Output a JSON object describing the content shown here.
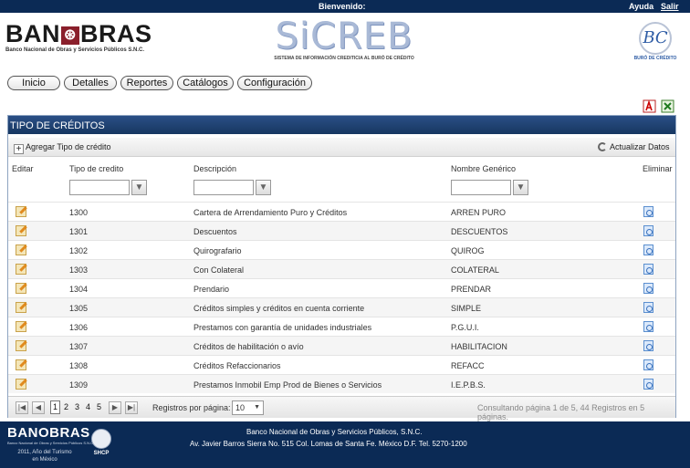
{
  "topbar": {
    "welcome": "Bienvenido:",
    "help": "Ayuda",
    "logout": "Salir"
  },
  "header": {
    "brand_word_left": "BAN",
    "brand_word_right": "BRAS",
    "brand_subtitle": "Banco Nacional de Obras y Servicios Públicos S.N.C.",
    "system_name": "SiCREB",
    "system_subtitle": "SISTEMA DE INFORMACIÓN CREDITICIA AL BURÓ DE CRÉDITO",
    "bc_logo_text": "BC",
    "bc_caption": "BURÓ DE CRÉDITO"
  },
  "nav": [
    "Inicio",
    "Detalles",
    "Reportes",
    "Catálogos",
    "Configuración"
  ],
  "toolbar": {
    "pdf_icon": "pdf-export-icon",
    "excel_icon": "excel-export-icon"
  },
  "grid": {
    "title": "TIPO DE CRÉDITOS",
    "add_label": "Agregar Tipo de crédito",
    "refresh_label": "Actualizar Datos",
    "columns": {
      "edit": "Editar",
      "type": "Tipo de credito",
      "description": "Descripción",
      "generic": "Nombre Genérico",
      "delete": "Eliminar"
    },
    "filters": {
      "type": "",
      "description": "",
      "generic": ""
    },
    "rows": [
      {
        "type": "1300",
        "description": "Cartera de Arrendamiento Puro y Créditos",
        "generic": "ARREN PURO"
      },
      {
        "type": "1301",
        "description": "Descuentos",
        "generic": "DESCUENTOS"
      },
      {
        "type": "1302",
        "description": "Quirografario",
        "generic": "QUIROG"
      },
      {
        "type": "1303",
        "description": "Con Colateral",
        "generic": "COLATERAL"
      },
      {
        "type": "1304",
        "description": "Prendario",
        "generic": "PRENDAR"
      },
      {
        "type": "1305",
        "description": "Créditos simples y créditos en cuenta corriente",
        "generic": "SIMPLE"
      },
      {
        "type": "1306",
        "description": "Prestamos con garantía de unidades industriales",
        "generic": "P.G.U.I."
      },
      {
        "type": "1307",
        "description": "Créditos de habilitación o avío",
        "generic": "HABILITACION"
      },
      {
        "type": "1308",
        "description": "Créditos Refaccionarios",
        "generic": "REFACC"
      },
      {
        "type": "1309",
        "description": "Prestamos Inmobil Emp Prod de Bienes o Servicios",
        "generic": "I.E.P.B.S."
      }
    ],
    "pager": {
      "pages": [
        "1",
        "2",
        "3",
        "4",
        "5"
      ],
      "current_page": "1",
      "page_size_label": "Registros por página:",
      "page_size": "10",
      "info": "Consultando página 1 de 5, 44 Registros en 5 páginas."
    }
  },
  "footer": {
    "brand": "BANOBRAS",
    "brand_sub": "Banco Nacional de Obras y Servicios Públicos S.N.C.",
    "year_line1": "2011, Año del Turismo",
    "year_line2": "en México",
    "shcp": "SHCP",
    "address_line1": "Banco Nacional de Obras y Servicios Públicos, S.N.C.",
    "address_line2": "Av. Javier Barros Sierra No. 515 Col. Lomas de Santa Fe. México D.F. Tel. 5270-1200"
  }
}
